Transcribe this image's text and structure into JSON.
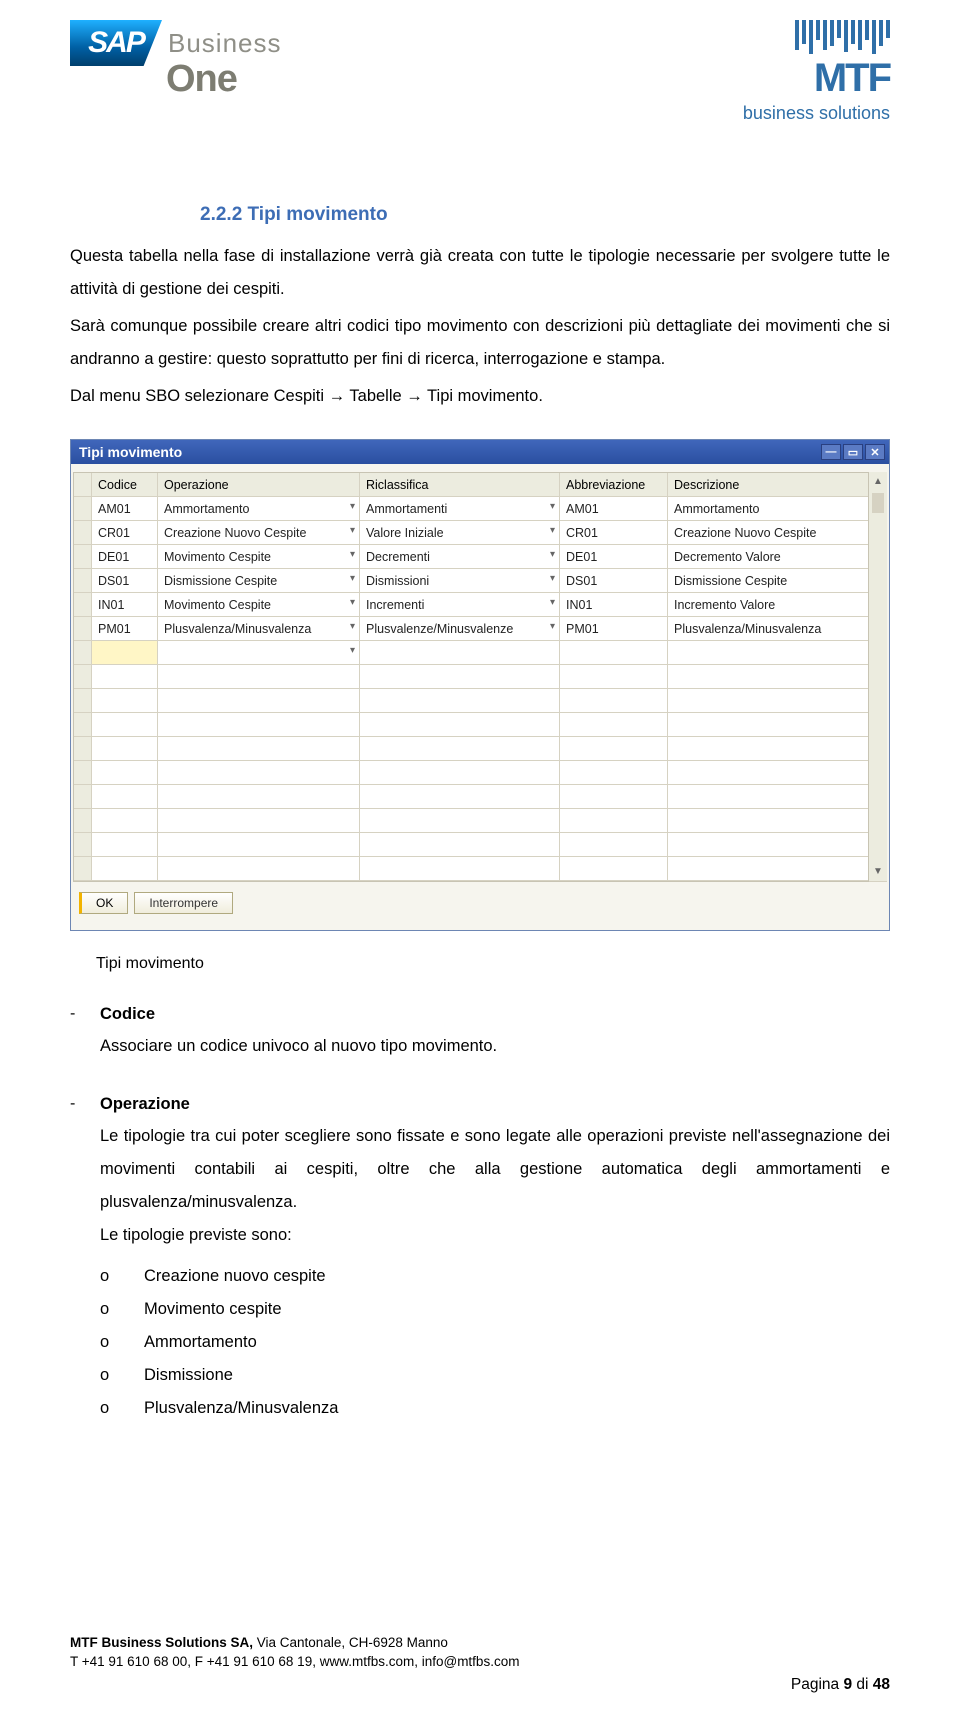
{
  "header": {
    "sap_badge": "SAP",
    "sap_word1": "Business",
    "sap_word2": "One",
    "mtf_name": "MTF",
    "mtf_sub": "business solutions"
  },
  "section": {
    "heading": "2.2.2 Tipi movimento",
    "para1": "Questa tabella nella fase di installazione verrà già creata con tutte le tipologie necessarie per svolgere tutte le attività di gestione dei cespiti.",
    "para2": "Sarà comunque possibile creare altri codici tipo movimento con descrizioni più dettagliate dei movimenti che si andranno a gestire: questo soprattutto per fini di ricerca, interrogazione e stampa.",
    "para3": "Dal menu SBO selezionare Cespiti → Tabelle → Tipi movimento."
  },
  "window": {
    "title": "Tipi movimento",
    "columns": {
      "codice": "Codice",
      "operazione": "Operazione",
      "riclassifica": "Riclassifica",
      "abbrev": "Abbreviazione",
      "descrizione": "Descrizione"
    },
    "rows": [
      {
        "codice": "AM01",
        "oper": "Ammortamento",
        "riclass": "Ammortamenti",
        "abbrev": "AM01",
        "descr": "Ammortamento"
      },
      {
        "codice": "CR01",
        "oper": "Creazione Nuovo Cespite",
        "riclass": "Valore Iniziale",
        "abbrev": "CR01",
        "descr": "Creazione Nuovo Cespite"
      },
      {
        "codice": "DE01",
        "oper": "Movimento Cespite",
        "riclass": "Decrementi",
        "abbrev": "DE01",
        "descr": "Decremento Valore"
      },
      {
        "codice": "DS01",
        "oper": "Dismissione Cespite",
        "riclass": "Dismissioni",
        "abbrev": "DS01",
        "descr": "Dismissione Cespite"
      },
      {
        "codice": "IN01",
        "oper": "Movimento Cespite",
        "riclass": "Incrementi",
        "abbrev": "IN01",
        "descr": "Incremento Valore"
      },
      {
        "codice": "PM01",
        "oper": "Plusvalenza/Minusvalenza",
        "riclass": "Plusvalenze/Minusvalenze",
        "abbrev": "PM01",
        "descr": "Plusvalenza/Minusvalenza"
      }
    ],
    "ok_label": "OK",
    "cancel_label": "Interrompere"
  },
  "caption": "Tipi movimento",
  "bullets": {
    "codice_title": "Codice",
    "codice_text": "Associare un codice univoco al nuovo tipo movimento.",
    "oper_title": "Operazione",
    "oper_text": "Le tipologie tra cui poter scegliere sono fissate e sono legate alle operazioni previste nell'assegnazione dei movimenti contabili ai cespiti, oltre che alla gestione automatica degli ammortamenti e plusvalenza/minusvalenza.",
    "oper_list_intro": "Le tipologie previste sono:",
    "oper_items": [
      "Creazione nuovo cespite",
      "Movimento cespite",
      "Ammortamento",
      "Dismissione",
      "Plusvalenza/Minusvalenza"
    ]
  },
  "footer": {
    "line1a": "MTF Business Solutions SA,",
    "line1b": " Via Cantonale, CH-6928 Manno",
    "line2": "T +41 91 610 68 00, F +41 91 610 68 19, www.mtfbs.com, info@mtfbs.com",
    "page_prefix": "Pagina ",
    "page_num": "9",
    "page_mid": " di ",
    "page_total": "48"
  }
}
